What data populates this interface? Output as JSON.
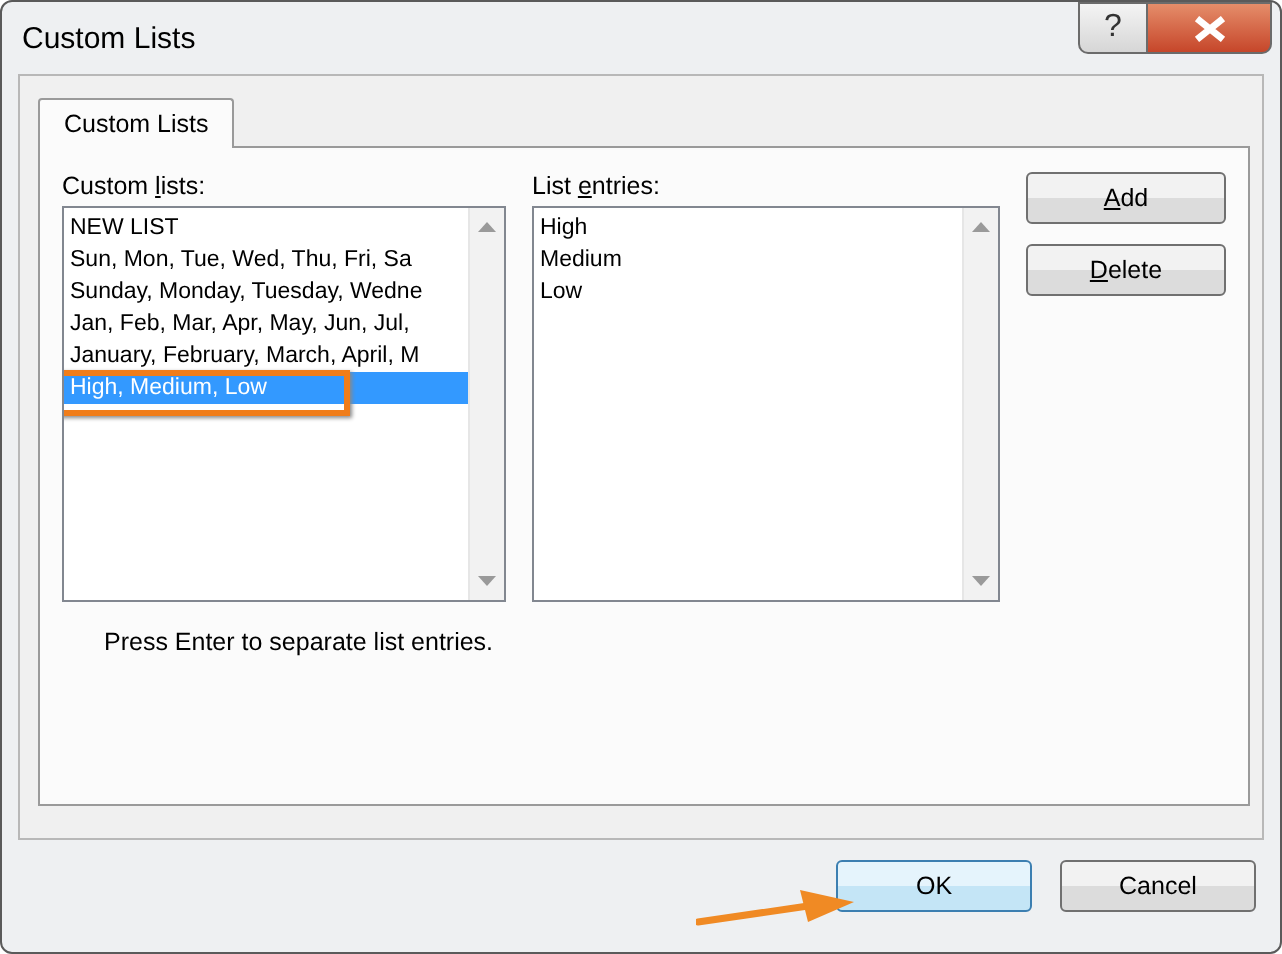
{
  "window": {
    "title": "Custom Lists",
    "controls": [
      {
        "kind": "help",
        "label": "?"
      },
      {
        "kind": "close"
      }
    ]
  },
  "tabs": [
    {
      "label": "Custom Lists",
      "selected": true
    }
  ],
  "custom_lists": {
    "label": [
      "Custom ",
      "l",
      "ists:"
    ],
    "items": [
      {
        "text": "NEW LIST",
        "selected": false
      },
      {
        "text": "Sun, Mon, Tue, Wed, Thu, Fri, Sa",
        "selected": false
      },
      {
        "text": "Sunday, Monday, Tuesday, Wedne",
        "selected": false
      },
      {
        "text": "Jan, Feb, Mar, Apr, May, Jun, Jul,",
        "selected": false
      },
      {
        "text": "January, February, March, April, M",
        "selected": false
      },
      {
        "text": "High, Medium, Low",
        "selected": true
      }
    ]
  },
  "list_entries": {
    "label": [
      "List ",
      "e",
      "ntries:"
    ],
    "lines": [
      "High",
      "Medium",
      "Low"
    ]
  },
  "side_buttons": [
    {
      "label": [
        "A",
        "dd"
      ],
      "access_key_first": true
    },
    {
      "label": [
        "D",
        "elete"
      ],
      "access_key_first": true
    }
  ],
  "hint": "Press Enter to separate list entries.",
  "buttons": [
    {
      "label": "OK",
      "default": true
    },
    {
      "label": "Cancel",
      "default": false
    }
  ],
  "annotations": {
    "highlight_selected": true,
    "arrow_to_default": true
  }
}
